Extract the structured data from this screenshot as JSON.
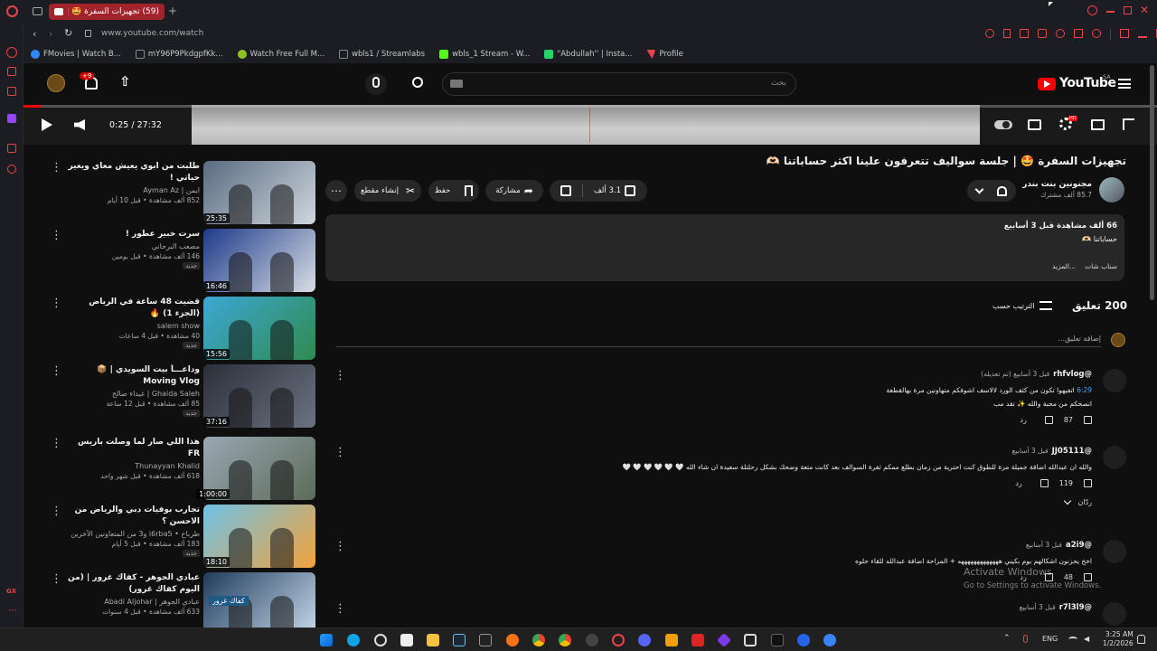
{
  "browser": {
    "tab": {
      "title": "(59) تجهيزات السفرة 🤩 | جلس",
      "count_badge": "(59)"
    },
    "new_tab_label": "+",
    "url": "www.youtube.com/watch",
    "bookmarks": [
      {
        "label": "FMovies | Watch B...",
        "color": "#2e88ff"
      },
      {
        "label": "mY96P9PkdgpfKk...",
        "color": "#444"
      },
      {
        "label": "Watch Free Full M...",
        "color": "#8fc31f"
      },
      {
        "label": "wbls1 / Streamlabs",
        "color": "#222"
      },
      {
        "label": "wbls_1 Stream - W...",
        "color": "#53fc18"
      },
      {
        "label": "\"Abdullah'' | Insta...",
        "color": "#25d366"
      },
      {
        "label": "Profile",
        "color": "#e9424a"
      }
    ]
  },
  "yt_header": {
    "logo": "YouTube",
    "region": "SA",
    "search_placeholder": "بحث",
    "notification_count": "+9"
  },
  "player": {
    "time": "0:25 / 27:32",
    "progress_fraction": 0.015
  },
  "video": {
    "title": "تجهيزات السفرة 🤩 | جلسة سواليف تتعرفون علينا اكثر حساباتنا 🫶🏻",
    "channel": "مجنونين بنت بندر",
    "subscribers": "85.7 ألف مشترك",
    "likes": "3.1 ألف",
    "share_label": "مشاركة",
    "save_label": "حفظ",
    "clip_label": "إنشاء مقطع",
    "description": {
      "stats": "66 ألف مشاهدة  قبل 3 أسابيع",
      "text": "حساباتنا 🫶🏻",
      "more": "...المزيد",
      "snap": "سناب شات"
    }
  },
  "comments": {
    "count_label": "200 تعليق",
    "sort_label": "الترتيب حسب",
    "add_placeholder": "إضافة تعليق...",
    "items": [
      {
        "author": "@rhfvlog",
        "time": "قبل 3 أسابيع (تم تعديله)",
        "timestamp_link": "6:29",
        "text": "اتفيهوا تكون من كثف الورد لالاسف اشوفكم متهاونين مرة بهالقطعة",
        "text2": "انصحكم من محبة والله ✨ تقد مب",
        "likes": "87",
        "reply": "رد"
      },
      {
        "author": "@JJ05111",
        "time": "قبل 3 أسابيع",
        "text": "والله ان عبدالله اضافة جميلة مرة للطوق كنت احترية من زمان بطلع ممكم ثفرة السوالف بعد كانت متعة وضحك بشكل رحلتلة سعيدة ان شاء الله 🤍 🤍 🤍 🤍 🤍 🤍",
        "likes": "119",
        "reply": "رد",
        "replies_label": "ردّان"
      },
      {
        "author": "@a2i9",
        "time": "قبل 3 أسابيع",
        "text": "اخخ يحزنون اشكالهم يوم بكيني هههههههههههههه + المزاحة اضافة عبدالله للقاء حلوه",
        "likes": "48",
        "reply": "رد"
      },
      {
        "author": "@r7l3l9",
        "time": "قبل 3 أسابيع",
        "text": "",
        "likes": "",
        "reply": ""
      }
    ]
  },
  "recommendations": [
    {
      "title": "طلبت من ابوي يعيش معاي ويغير حياتي !",
      "channel": "ايمن | Ayman Az",
      "views": "852 ألف مشاهدة • قبل 10 أيام",
      "duration": "25:35",
      "new": "",
      "colors": [
        "#5a6b80",
        "#cfd6de"
      ]
    },
    {
      "title": "سرت خبير عطور !",
      "channel": "مصعب البرحاني",
      "views": "146 ألف مشاهدة • قبل يومين",
      "duration": "16:46",
      "new": "جديد",
      "colors": [
        "#1d3a8a",
        "#d9dde4"
      ]
    },
    {
      "title": "قضيت 48 ساعة في الرياض (الجزء 1) 🔥",
      "channel": "salem show",
      "views": "40 مشاهدة • قبل 4 ساعات",
      "duration": "15:56",
      "new": "جديد",
      "colors": [
        "#3ea7d6",
        "#2e8b4f"
      ]
    },
    {
      "title": "وداعـــاً بيت السويدي | 📦 Moving Vlog",
      "channel": "Ghaida Saleh | غيداء صالح",
      "views": "85 ألف مشاهدة • قبل 12 ساعة",
      "duration": "37:16",
      "new": "جديد",
      "colors": [
        "#2b2f3a",
        "#6b7280"
      ]
    },
    {
      "title": "هذا اللي صار لما وصلت باريس FR",
      "channel": "Thunayyan Khalid",
      "views": "618 ألف مشاهدة • قبل شهر واحد",
      "duration": "1:00:00",
      "new": "",
      "colors": [
        "#9aa7b4",
        "#5c6b58"
      ]
    },
    {
      "title": "تجارب بوفيات دبي والرياض من الاحسن ؟",
      "channel": "طرباخ • i6rba5 و3 من المتعاونين الآخرين",
      "views": "183 ألف مشاهدة • قبل 5 أيام",
      "duration": "18:10",
      "new": "جديد",
      "colors": [
        "#6fc2e8",
        "#f2a23c"
      ]
    },
    {
      "title": "عبادي الجوهر - كفاك غرور | (من اليوم كفاك غرور)",
      "channel": "عبادي الجوهر | Abadi Aljohar",
      "views": "633 ألف مشاهدة • قبل 4 سنوات",
      "duration": "",
      "new": "",
      "colors": [
        "#1f3b5c",
        "#c7d9ea"
      ],
      "thumb_text": "كفاك غرور"
    }
  ],
  "watermark": {
    "line1": "Activate Windows",
    "line2": "Go to Settings to activate Windows."
  },
  "taskbar": {
    "lang": "ENG",
    "time": "3:25 AM",
    "date": "1/2/2026"
  }
}
